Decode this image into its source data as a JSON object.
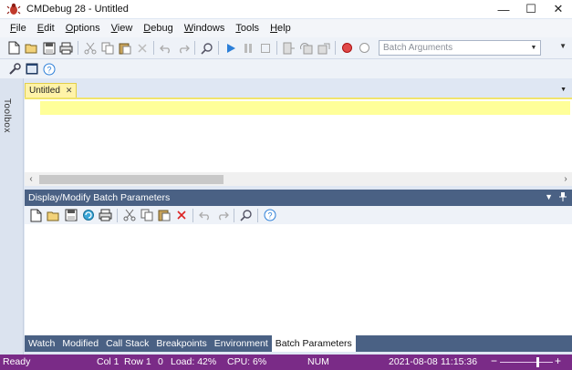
{
  "window": {
    "title": "CMDebug 28 - Untitled",
    "minimize_glyph": "—",
    "maximize_glyph": "☐",
    "close_glyph": "✕"
  },
  "menu": [
    {
      "label": "File",
      "mnemonic": "F",
      "rest": "ile"
    },
    {
      "label": "Edit",
      "mnemonic": "E",
      "rest": "dit"
    },
    {
      "label": "Options",
      "mnemonic": "O",
      "rest": "ptions"
    },
    {
      "label": "View",
      "mnemonic": "V",
      "rest": "iew"
    },
    {
      "label": "Debug",
      "mnemonic": "D",
      "rest": "ebug"
    },
    {
      "label": "Windows",
      "mnemonic": "W",
      "rest": "indows"
    },
    {
      "label": "Tools",
      "mnemonic": "T",
      "rest": "ools"
    },
    {
      "label": "Help",
      "mnemonic": "H",
      "rest": "elp"
    }
  ],
  "toolbar": {
    "batch_args_placeholder": "Batch Arguments",
    "icons": [
      "new-file-icon",
      "open-folder-icon",
      "save-icon",
      "print-icon",
      "cut-icon",
      "copy-icon",
      "paste-icon",
      "delete-icon",
      "undo-icon",
      "redo-icon",
      "find-icon",
      "run-icon",
      "pause-icon",
      "stop-icon",
      "step-into-icon",
      "step-over-icon",
      "step-out-icon",
      "breakpoint-icon",
      "clear-breakpoint-icon"
    ],
    "icons_row2": [
      "settings-wrench-icon",
      "console-icon",
      "help-icon"
    ]
  },
  "toolbox": {
    "label": "Toolbox"
  },
  "document": {
    "tab_label": "Untitled",
    "tab_close_glyph": "✕"
  },
  "panel": {
    "title": "Display/Modify Batch Parameters",
    "pin_glyph": "📌"
  },
  "bottom_tabs": [
    {
      "label": "Watch",
      "active": false
    },
    {
      "label": "Modified",
      "active": false
    },
    {
      "label": "Call Stack",
      "active": false
    },
    {
      "label": "Breakpoints",
      "active": false
    },
    {
      "label": "Environment",
      "active": false
    },
    {
      "label": "Batch Parameters",
      "active": true
    }
  ],
  "status": {
    "ready": "Ready",
    "col": "Col 1",
    "row": "Row 1",
    "count": "0",
    "load": "Load: 42%",
    "cpu": "CPU:  6%",
    "num": "NUM",
    "date": "2021-08-08",
    "time": "11:15:36",
    "zoom_level": 0.7
  },
  "colors": {
    "status_bar": "#7a2b87",
    "panel_header": "#4a6184",
    "current_line": "#ffff99",
    "doc_tab": "#fff3a8"
  }
}
